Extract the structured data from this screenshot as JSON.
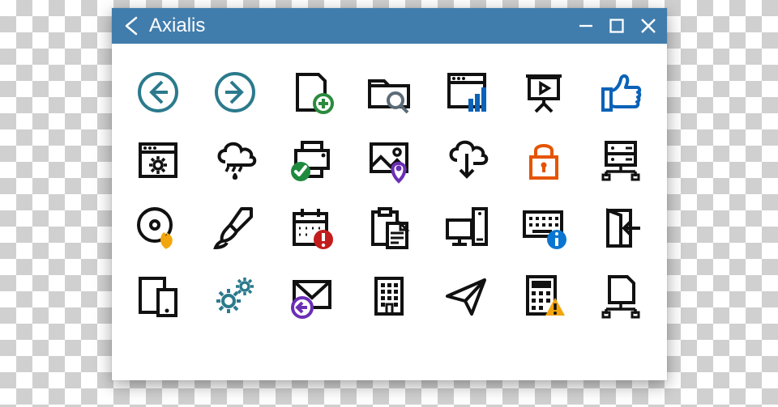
{
  "window": {
    "title": "Axialis"
  },
  "colors": {
    "titlebar": "#417dac",
    "teal": "#2b7a8c",
    "green": "#2b8a3e",
    "blue": "#0b62b8",
    "orange": "#e55400",
    "purple": "#6b2fb5",
    "greenCheck": "#1f8a3e",
    "red": "#c21c1c",
    "yellow": "#f2a60d",
    "infoBlue": "#0b76d1",
    "gray": "#535353",
    "black": "#111111"
  },
  "icons": [
    [
      "arrow-back-circle",
      "arrow-forward-circle",
      "new-file-add",
      "folder-search",
      "window-bar-chart",
      "presentation-play",
      "thumbs-up"
    ],
    [
      "settings-window",
      "rain-cloud",
      "printer-check",
      "image-pin",
      "cloud-download",
      "lock",
      "server-network"
    ],
    [
      "disc-burn",
      "paint-brush",
      "calendar-alert",
      "clipboard-paste",
      "computer-desktop",
      "keyboard-info",
      "enter-door"
    ],
    [
      "devices",
      "gears",
      "mail-reply",
      "office-building",
      "paper-plane-send",
      "calculator-warning",
      "file-network"
    ]
  ]
}
